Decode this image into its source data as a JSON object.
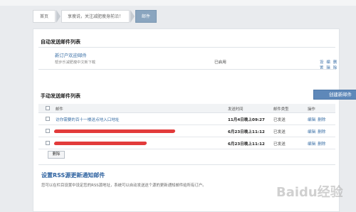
{
  "breadcrumb": [
    {
      "label": "首页"
    },
    {
      "label": "享瘦说，关注减肥瘦身前沿！"
    },
    {
      "label": "邮件"
    }
  ],
  "auto_section": {
    "title": "自动发送邮件列表",
    "item": {
      "name": "新订户欢迎邮件",
      "desc": "帮步乐减肥瘦中文新下载",
      "status": "已启用",
      "actions": [
        "设置",
        "编辑",
        "删除"
      ]
    }
  },
  "manual_section": {
    "title": "手动发送邮件列表",
    "create_button": "创建新邮件",
    "columns": [
      "邮件",
      "发送时间",
      "邮件类型",
      "操作"
    ],
    "rows": [
      {
        "subject": "访你需要的百十一楼送点地入口地址",
        "time": "11月4日晚上09:27",
        "type": "已发送",
        "actions": [
          "编辑",
          "删除"
        ]
      },
      {
        "subject": "",
        "time": "6月23日晚上11:12",
        "type": "已发送",
        "actions": [
          "编辑",
          "删除"
        ]
      },
      {
        "subject": "",
        "time": "6月23日晚上11:12",
        "type": "已发送",
        "actions": [
          "编辑",
          "删除"
        ]
      }
    ],
    "delete_button": "删除"
  },
  "rss": {
    "title": "设置RSS源更新通知邮件",
    "desc": "您可以在栏目设置中设定您的RSS源地址，系统可以自动发送这个源的更新通知邮件给所有订户。"
  },
  "watermark": "Baidu经验",
  "colors": {
    "link": "#3a6fa6",
    "button": "#5e88b9",
    "redaction": "#e23b3b"
  }
}
